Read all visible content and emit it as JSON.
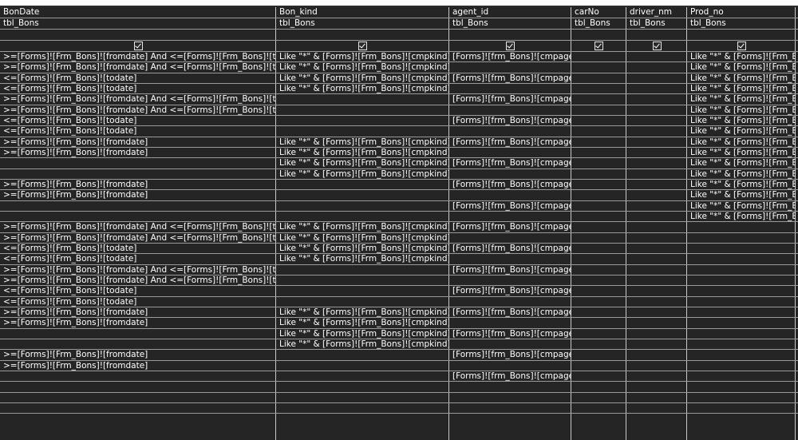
{
  "columns": [
    {
      "field": "BonDate",
      "table": "tbl_Bons",
      "show": true
    },
    {
      "field": "Bon_kind",
      "table": "tbl_Bons",
      "show": true
    },
    {
      "field": "agent_id",
      "table": "tbl_Bons",
      "show": true
    },
    {
      "field": "carNo",
      "table": "tbl_Bons",
      "show": true
    },
    {
      "field": "driver_nm",
      "table": "tbl_Bons",
      "show": true
    },
    {
      "field": "Prod_no",
      "table": "tbl_Bons",
      "show": true
    }
  ],
  "criteria_rows": [
    [
      ">=[Forms]![Frm_Bons]![fromdate] And <=[Forms]![Frm_Bons]![todate]",
      "Like \"*\" & [Forms]![Frm_Bons]![cmpkind] & \"*",
      "[Forms]![frm_Bons]![cmpagen]",
      "",
      "",
      "Like \"*\" & [Forms]![Frm_Bon"
    ],
    [
      ">=[Forms]![Frm_Bons]![fromdate] And <=[Forms]![Frm_Bons]![todate]",
      "Like \"*\" & [Forms]![Frm_Bons]![cmpkind] & \"*",
      "",
      "",
      "",
      "Like \"*\" & [Forms]![Frm_Bon"
    ],
    [
      "<=[Forms]![Frm_Bons]![todate]",
      "Like \"*\" & [Forms]![Frm_Bons]![cmpkind] & \"*",
      "[Forms]![frm_Bons]![cmpagen]",
      "",
      "",
      "Like \"*\" & [Forms]![Frm_Bon"
    ],
    [
      "<=[Forms]![Frm_Bons]![todate]",
      "Like \"*\" & [Forms]![Frm_Bons]![cmpkind] & \"*",
      "",
      "",
      "",
      "Like \"*\" & [Forms]![Frm_Bon"
    ],
    [
      ">=[Forms]![Frm_Bons]![fromdate] And <=[Forms]![Frm_Bons]![todate]",
      "",
      "[Forms]![frm_Bons]![cmpagen]",
      "",
      "",
      "Like \"*\" & [Forms]![Frm_Bon"
    ],
    [
      ">=[Forms]![Frm_Bons]![fromdate] And <=[Forms]![Frm_Bons]![todate]",
      "",
      "",
      "",
      "",
      "Like \"*\" & [Forms]![Frm_Bon"
    ],
    [
      "<=[Forms]![Frm_Bons]![todate]",
      "",
      "[Forms]![frm_Bons]![cmpagen]",
      "",
      "",
      "Like \"*\" & [Forms]![Frm_Bon"
    ],
    [
      "<=[Forms]![Frm_Bons]![todate]",
      "",
      "",
      "",
      "",
      "Like \"*\" & [Forms]![Frm_Bon"
    ],
    [
      ">=[Forms]![Frm_Bons]![fromdate]",
      "Like \"*\" & [Forms]![Frm_Bons]![cmpkind] & \"*",
      "[Forms]![frm_Bons]![cmpagen]",
      "",
      "",
      "Like \"*\" & [Forms]![Frm_Bon"
    ],
    [
      ">=[Forms]![Frm_Bons]![fromdate]",
      "Like \"*\" & [Forms]![Frm_Bons]![cmpkind] & \"*",
      "",
      "",
      "",
      "Like \"*\" & [Forms]![Frm_Bon"
    ],
    [
      "",
      "Like \"*\" & [Forms]![Frm_Bons]![cmpkind] & \"*",
      "[Forms]![frm_Bons]![cmpagen]",
      "",
      "",
      "Like \"*\" & [Forms]![Frm_Bon"
    ],
    [
      "",
      "Like \"*\" & [Forms]![Frm_Bons]![cmpkind] & \"*",
      "",
      "",
      "",
      "Like \"*\" & [Forms]![Frm_Bon"
    ],
    [
      ">=[Forms]![Frm_Bons]![fromdate]",
      "",
      "[Forms]![frm_Bons]![cmpagen]",
      "",
      "",
      "Like \"*\" & [Forms]![Frm_Bon"
    ],
    [
      ">=[Forms]![Frm_Bons]![fromdate]",
      "",
      "",
      "",
      "",
      "Like \"*\" & [Forms]![Frm_Bon"
    ],
    [
      "",
      "",
      "[Forms]![frm_Bons]![cmpagen]",
      "",
      "",
      "Like \"*\" & [Forms]![Frm_Bon"
    ],
    [
      "",
      "",
      "",
      "",
      "",
      "Like \"*\" & [Forms]![Frm_Bon"
    ],
    [
      ">=[Forms]![Frm_Bons]![fromdate] And <=[Forms]![Frm_Bons]![todate]",
      "Like \"*\" & [Forms]![Frm_Bons]![cmpkind] & \"*",
      "[Forms]![frm_Bons]![cmpagen]",
      "",
      "",
      ""
    ],
    [
      ">=[Forms]![Frm_Bons]![fromdate] And <=[Forms]![Frm_Bons]![todate]",
      "Like \"*\" & [Forms]![Frm_Bons]![cmpkind] & \"*",
      "",
      "",
      "",
      ""
    ],
    [
      "<=[Forms]![Frm_Bons]![todate]",
      "Like \"*\" & [Forms]![Frm_Bons]![cmpkind] & \"*",
      "[Forms]![frm_Bons]![cmpagen]",
      "",
      "",
      ""
    ],
    [
      "<=[Forms]![Frm_Bons]![todate]",
      "Like \"*\" & [Forms]![Frm_Bons]![cmpkind] & \"*",
      "",
      "",
      "",
      ""
    ],
    [
      ">=[Forms]![Frm_Bons]![fromdate] And <=[Forms]![Frm_Bons]![todate]",
      "",
      "[Forms]![frm_Bons]![cmpagen]",
      "",
      "",
      ""
    ],
    [
      ">=[Forms]![Frm_Bons]![fromdate] And <=[Forms]![Frm_Bons]![todate]",
      "",
      "",
      "",
      "",
      ""
    ],
    [
      "<=[Forms]![Frm_Bons]![todate]",
      "",
      "[Forms]![frm_Bons]![cmpagen]",
      "",
      "",
      ""
    ],
    [
      "<=[Forms]![Frm_Bons]![todate]",
      "",
      "",
      "",
      "",
      ""
    ],
    [
      ">=[Forms]![Frm_Bons]![fromdate]",
      "Like \"*\" & [Forms]![Frm_Bons]![cmpkind] & \"*",
      "[Forms]![frm_Bons]![cmpagen]",
      "",
      "",
      ""
    ],
    [
      ">=[Forms]![Frm_Bons]![fromdate]",
      "Like \"*\" & [Forms]![Frm_Bons]![cmpkind] & \"*",
      "",
      "",
      "",
      ""
    ],
    [
      "",
      "Like \"*\" & [Forms]![Frm_Bons]![cmpkind] & \"*",
      "[Forms]![frm_Bons]![cmpagen]",
      "",
      "",
      ""
    ],
    [
      "",
      "Like \"*\" & [Forms]![Frm_Bons]![cmpkind] & \"*",
      "",
      "",
      "",
      ""
    ],
    [
      ">=[Forms]![Frm_Bons]![fromdate]",
      "",
      "[Forms]![frm_Bons]![cmpagen]",
      "",
      "",
      ""
    ],
    [
      ">=[Forms]![Frm_Bons]![fromdate]",
      "",
      "",
      "",
      "",
      ""
    ],
    [
      "",
      "",
      "[Forms]![frm_Bons]![cmpagen]",
      "",
      "",
      ""
    ],
    [
      "",
      "",
      "",
      "",
      "",
      ""
    ],
    [
      "",
      "",
      "",
      "",
      "",
      ""
    ],
    [
      "",
      "",
      "",
      "",
      "",
      ""
    ]
  ]
}
